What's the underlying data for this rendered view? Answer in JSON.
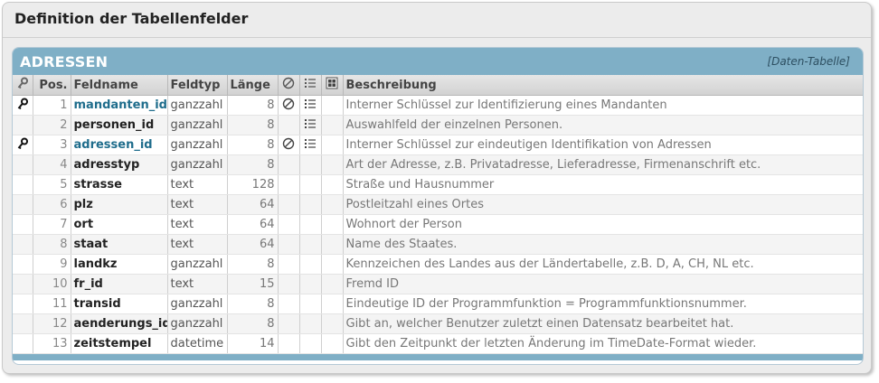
{
  "page": {
    "title": "Definition der Tabellenfelder"
  },
  "table": {
    "name": "ADRESSEN",
    "type_label": "[Daten-Tabelle]",
    "columns": {
      "key_icon": "key-icon",
      "pos": "Pos.",
      "fieldname": "Feldname",
      "fieldtype": "Feldtyp",
      "length": "Länge",
      "notnull_icon": "no-entry-icon",
      "index_icon": "list-icon",
      "auto_icon": "grid-icon",
      "description": "Beschreibung"
    },
    "rows": [
      {
        "pos": "1",
        "name": "mandanten_id",
        "type": "ganzzahl",
        "length": "8",
        "key": true,
        "notnull": true,
        "index": true,
        "desc": "Interner Schlüssel zur Identifizierung eines Mandanten"
      },
      {
        "pos": "2",
        "name": "personen_id",
        "type": "ganzzahl",
        "length": "8",
        "key": false,
        "notnull": false,
        "index": true,
        "desc": "Auswahlfeld der einzelnen Personen."
      },
      {
        "pos": "3",
        "name": "adressen_id",
        "type": "ganzzahl",
        "length": "8",
        "key": true,
        "notnull": true,
        "index": true,
        "desc": "Interner Schlüssel zur eindeutigen Identifikation von Adressen"
      },
      {
        "pos": "4",
        "name": "adresstyp",
        "type": "ganzzahl",
        "length": "8",
        "key": false,
        "notnull": false,
        "index": false,
        "desc": "Art der Adresse, z.B. Privatadresse, Lieferadresse, Firmenanschrift etc."
      },
      {
        "pos": "5",
        "name": "strasse",
        "type": "text",
        "length": "128",
        "key": false,
        "notnull": false,
        "index": false,
        "desc": "Straße und Hausnummer"
      },
      {
        "pos": "6",
        "name": "plz",
        "type": "text",
        "length": "64",
        "key": false,
        "notnull": false,
        "index": false,
        "desc": "Postleitzahl eines Ortes"
      },
      {
        "pos": "7",
        "name": "ort",
        "type": "text",
        "length": "64",
        "key": false,
        "notnull": false,
        "index": false,
        "desc": "Wohnort der Person"
      },
      {
        "pos": "8",
        "name": "staat",
        "type": "text",
        "length": "64",
        "key": false,
        "notnull": false,
        "index": false,
        "desc": "Name des Staates."
      },
      {
        "pos": "9",
        "name": "landkz",
        "type": "ganzzahl",
        "length": "8",
        "key": false,
        "notnull": false,
        "index": false,
        "desc": "Kennzeichen des Landes aus der Ländertabelle, z.B. D, A, CH, NL etc."
      },
      {
        "pos": "10",
        "name": "fr_id",
        "type": "text",
        "length": "15",
        "key": false,
        "notnull": false,
        "index": false,
        "desc": "Fremd ID"
      },
      {
        "pos": "11",
        "name": "transid",
        "type": "ganzzahl",
        "length": "8",
        "key": false,
        "notnull": false,
        "index": false,
        "desc": "Eindeutige ID der Programmfunktion = Programmfunktionsnummer."
      },
      {
        "pos": "12",
        "name": "aenderungs_id",
        "type": "ganzzahl",
        "length": "8",
        "key": false,
        "notnull": false,
        "index": false,
        "desc": "Gibt an, welcher Benutzer zuletzt einen Datensatz bearbeitet hat."
      },
      {
        "pos": "13",
        "name": "zeitstempel",
        "type": "datetime",
        "length": "14",
        "key": false,
        "notnull": false,
        "index": false,
        "desc": "Gibt den Zeitpunkt der letzten Änderung im TimeDate-Format wieder."
      }
    ]
  },
  "colors": {
    "header_bar": "#7fafc6",
    "key_field": "#1f6d8c"
  }
}
